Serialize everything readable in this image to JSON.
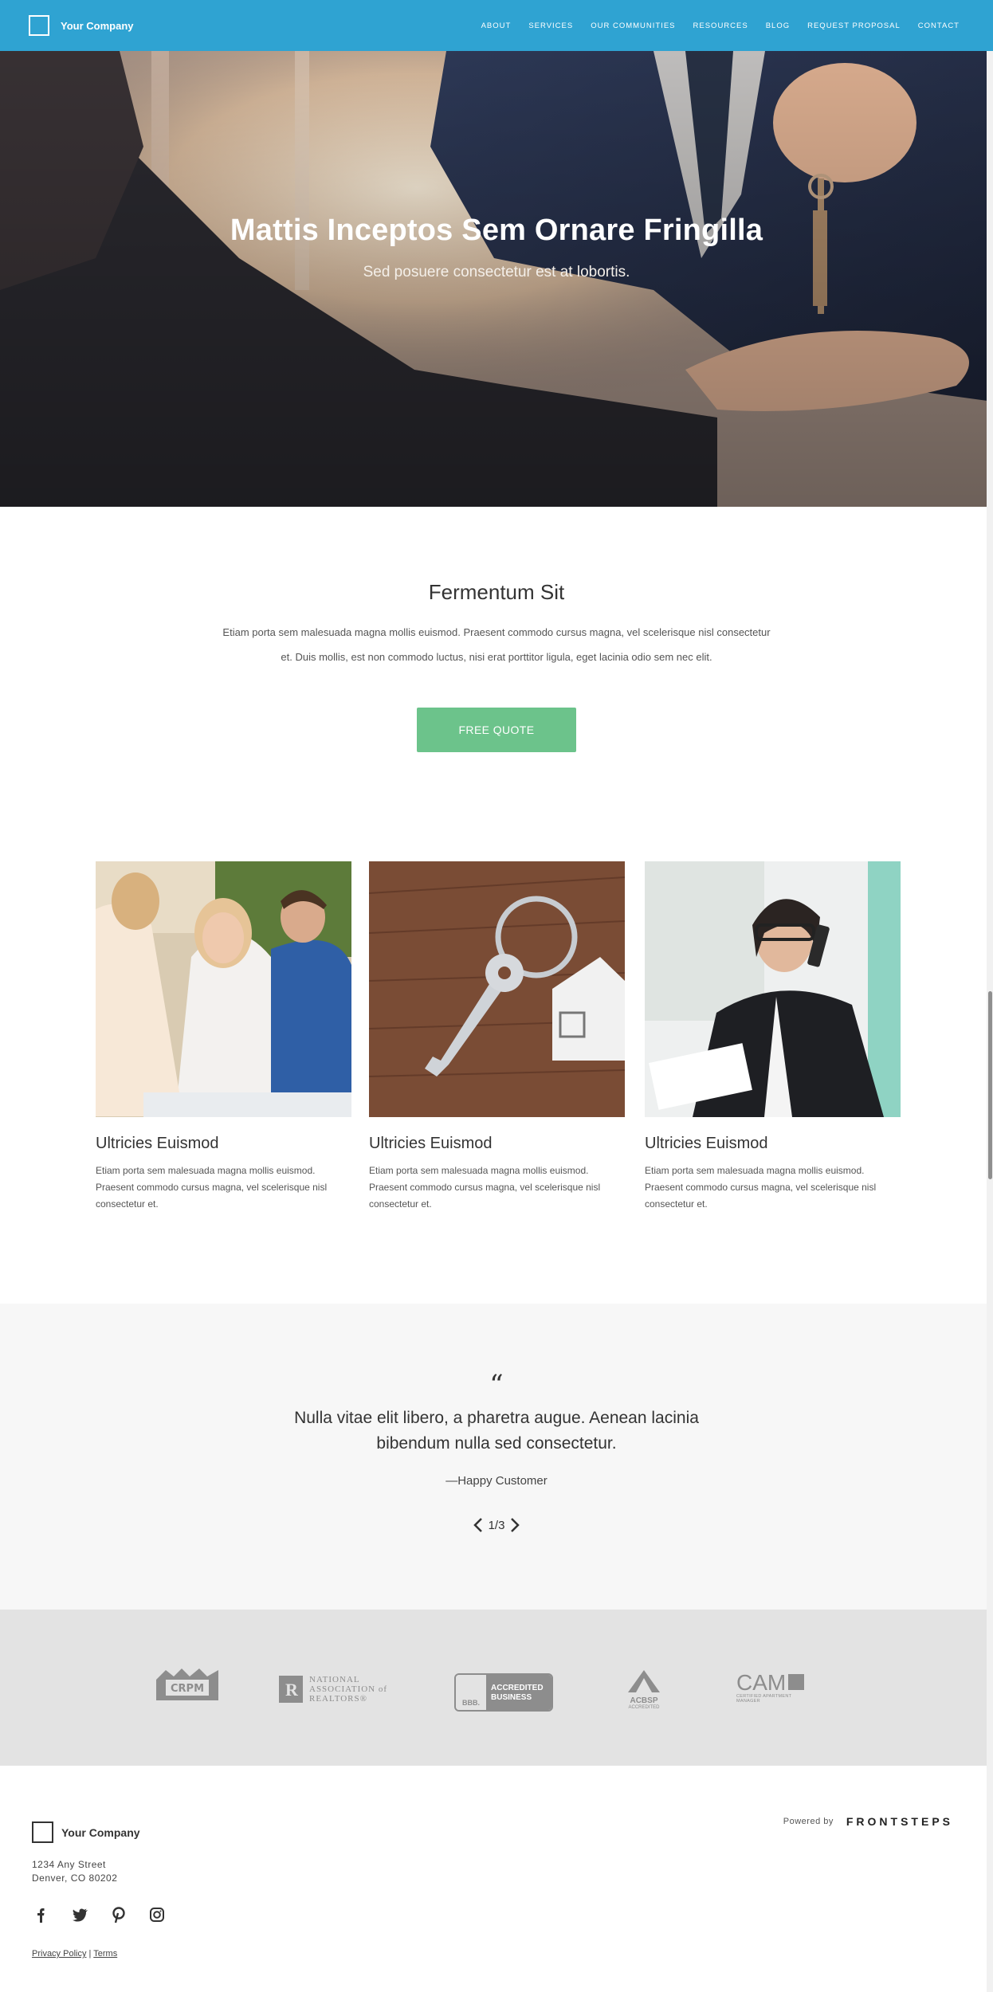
{
  "nav": {
    "brand": "Your Company",
    "items": [
      "ABOUT",
      "SERVICES",
      "OUR COMMUNITIES",
      "RESOURCES",
      "BLOG",
      "REQUEST PROPOSAL",
      "CONTACT"
    ]
  },
  "hero": {
    "title": "Mattis Inceptos Sem Ornare Fringilla",
    "subtitle": "Sed posuere consectetur est at lobortis."
  },
  "intro": {
    "title": "Fermentum Sit",
    "text": "Etiam porta sem malesuada magna mollis euismod. Praesent commodo cursus magna, vel scelerisque nisl consectetur et. Duis mollis, est non commodo luctus, nisi erat porttitor ligula, eget lacinia odio sem nec elit.",
    "button": "FREE QUOTE"
  },
  "cards": [
    {
      "title": "Ultricies Euismod",
      "text": "Etiam porta sem malesuada magna mollis euismod. Praesent commodo cursus magna, vel scelerisque nisl consectetur et."
    },
    {
      "title": "Ultricies Euismod",
      "text": "Etiam porta sem malesuada magna mollis euismod. Praesent commodo cursus magna, vel scelerisque nisl consectetur et."
    },
    {
      "title": "Ultricies Euismod",
      "text": "Etiam porta sem malesuada magna mollis euismod. Praesent commodo cursus magna, vel scelerisque nisl consectetur et."
    }
  ],
  "testimonial": {
    "mark": "“",
    "quote": "Nulla vitae elit libero, a pharetra augue. Aenean lacinia bibendum nulla sed consectetur.",
    "author": "—Happy Customer",
    "pager": "1/3"
  },
  "logos": {
    "crpm": "CRPM",
    "nar_line1": "NATIONAL",
    "nar_line2": "ASSOCIATION of",
    "nar_line3": "REALTORS®",
    "nar_small": "REALTOR",
    "bbb_line1": "ACCREDITED",
    "bbb_line2": "BUSINESS",
    "bbb_mark": "BBB.",
    "acbsp_line1": "ACBSP",
    "acbsp_line2": "ACCREDITED",
    "cam_main": "CAM",
    "cam_small1": "CERTIFIED APARTMENT",
    "cam_small2": "MANAGER"
  },
  "footer": {
    "brand": "Your Company",
    "address_line1": "1234 Any Street",
    "address_line2": "Denver, CO 80202",
    "privacy": "Privacy Policy",
    "separator": "|",
    "terms": "Terms",
    "powered_label": "Powered by",
    "powered_brand": "FRONTSTEPS"
  },
  "colors": {
    "nav": "#2fa3d2",
    "button": "#6cc38b",
    "testimonial_bg": "#f7f7f7",
    "logos_bg": "#e3e3e3"
  },
  "icons": [
    "facebook-icon",
    "twitter-icon",
    "pinterest-icon",
    "instagram-icon",
    "chevron-left-icon",
    "chevron-right-icon"
  ]
}
